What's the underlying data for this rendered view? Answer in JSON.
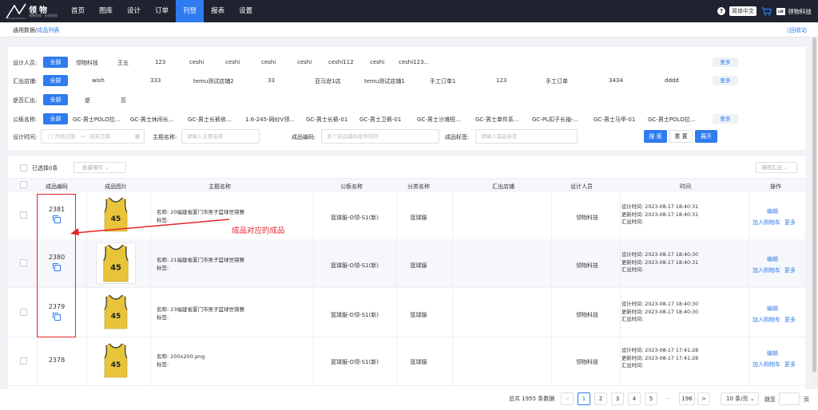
{
  "app": {
    "logo_text": "领物",
    "logo_sub": "领物科技 · 先进科技",
    "user": "领物科技",
    "lang": "简体中文",
    "avatar_text": "LW",
    "help": "?"
  },
  "nav": [
    "首页",
    "图库",
    "设计",
    "订单",
    "刊登",
    "报表",
    "设置"
  ],
  "nav_active": "刊登",
  "breadcrumb": {
    "parent": "通用数据/",
    "current": "成品列表"
  },
  "recycle": "回收站",
  "filters": {
    "all_label": "全部",
    "more_label": "更多",
    "designer": {
      "label": "设计人员:",
      "options": [
        "领物科技",
        "王五",
        "123",
        "ceshi",
        "ceshi",
        "ceshi",
        "ceshi",
        "ceshi112",
        "ceshi",
        "ceshi123..."
      ]
    },
    "store": {
      "label": "汇出店铺:",
      "options": [
        "wish",
        "333",
        "temu测试店铺2",
        "33",
        "亚马逊1店",
        "temu测试店铺1",
        "手工订单1",
        "123",
        "手工订单",
        "3434",
        "dddd"
      ]
    },
    "exported": {
      "label": "是否汇出:",
      "options": [
        "是",
        "否"
      ]
    },
    "template": {
      "label": "公板名称:",
      "options": [
        "GC-男士POLO拉...",
        "GC-男士休闲长...",
        "GC-男士长裤修...",
        "1.6-245-网纱V领...",
        "GC-男士长裤-01",
        "GC-男士卫裤-01",
        "GC-男士沙滩短...",
        "GC-男士单件系...",
        "GC-PL扣子长袖-...",
        "GC-男士马甲-01",
        "GC-男士POLO拉..."
      ]
    }
  },
  "search": {
    "time_label": "设计时间:",
    "start_placeholder": "开始日期",
    "arrow": "→",
    "end_placeholder": "结束日期",
    "theme_label": "主题名称:",
    "theme_placeholder": "请输入主题名称",
    "code_label": "成品编码:",
    "code_placeholder": "多个成品编码逗号隔开",
    "tag_label": "成品标签:",
    "tag_placeholder": "请输入成品标签",
    "search_btn": "搜 索",
    "reset_btn": "重 置",
    "expand_btn": "展开"
  },
  "toolbar": {
    "selected": "已选择0条",
    "batch": "批量操作",
    "sync": "通用汇出"
  },
  "columns": [
    "成品编码",
    "成品图片",
    "主题名称",
    "公板名称",
    "分类名称",
    "汇出店铺",
    "设计人员",
    "时间",
    "操作"
  ],
  "rows": [
    {
      "code": "2381",
      "name_line": "名称:  20福建省厦门市男子篮球世锦赛",
      "tag_line": "标签:",
      "template": "篮球服-O领-S1(新)",
      "category": "篮球服",
      "designer": "领物科技",
      "design_time": "设计时间:  2023-08-17 18:40:31",
      "update_time": "更新时间:  2023-08-17 18:40:31",
      "export_time": "汇出时间:"
    },
    {
      "code": "2380",
      "name_line": "名称:  21福建省厦门市男子篮球世锦赛",
      "tag_line": "标签:",
      "template": "篮球服-O领-S1(新)",
      "category": "篮球服",
      "designer": "领物科技",
      "design_time": "设计时间:  2023-08-17 18:40:30",
      "update_time": "更新时间:  2023-08-17 18:40:31",
      "export_time": "汇出时间:"
    },
    {
      "code": "2379",
      "name_line": "名称:  23福建省厦门市男子篮球世锦赛",
      "tag_line": "标签:",
      "template": "篮球服-O领-S1(新)",
      "category": "篮球服",
      "designer": "领物科技",
      "design_time": "设计时间:  2023-08-17 18:40:30",
      "update_time": "更新时间:  2023-08-17 18:40:30",
      "export_time": "汇出时间:"
    },
    {
      "code": "2378",
      "name_line": "名称:  200x200.png",
      "tag_line": "标签:",
      "template": "篮球服-O领-S1(新)",
      "category": "篮球服",
      "designer": "领物科技",
      "design_time": "设计时间:  2023-08-17 17:41:28",
      "update_time": "更新时间:  2023-08-17 17:41:28",
      "export_time": "汇出时间:"
    }
  ],
  "row_actions": {
    "edit": "编辑",
    "add_cart": "加入购物车",
    "more": "更多"
  },
  "jersey_number": "45",
  "annotation": "成品对应的成品",
  "pagination": {
    "total": "总共 1955 条数据",
    "prev": "<",
    "next": ">",
    "pages": [
      "1",
      "2",
      "3",
      "4",
      "5",
      "196"
    ],
    "current": "1",
    "ellipsis": "···",
    "page_size": "10 条/页",
    "jump_label": "跳至",
    "page_suffix": "页"
  },
  "colors": {
    "topbar": "#1f2330",
    "accent": "#2f7bf0",
    "annotation": "#e5262b",
    "jersey": "#e8c43a"
  }
}
